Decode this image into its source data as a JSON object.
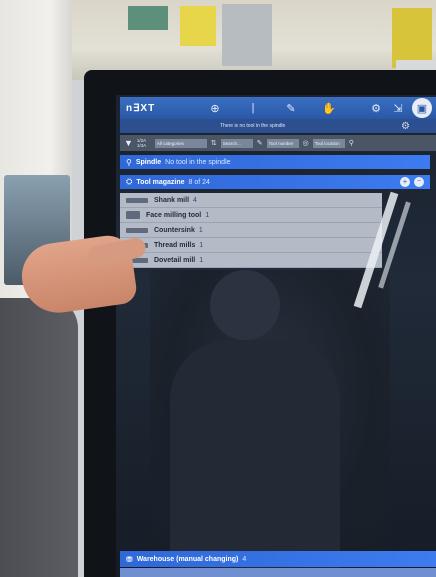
{
  "app": {
    "logo": "n∃XT"
  },
  "topbar": {
    "user_text": "",
    "icons": [
      "crosshair-icon",
      "line-icon",
      "edit-icon",
      "hand-icon",
      "tool-icon",
      "export-icon",
      "machine-icon"
    ]
  },
  "statusbar": {
    "message": "There is no tool in the spindle"
  },
  "filterbar": {
    "code_line1": "1/2A",
    "code_line2": "1/3A",
    "select_value": "All categories",
    "box1": "Search...",
    "box2": "Tool number",
    "box3": "Tool location"
  },
  "spindle": {
    "title": "Spindle",
    "subtitle": "No tool in the spindle"
  },
  "magazine": {
    "title": "Tool magazine",
    "count": "8 of 24"
  },
  "tools": [
    {
      "name": "Shank mill",
      "count": "4"
    },
    {
      "name": "Face milling tool",
      "count": "1"
    },
    {
      "name": "Countersink",
      "count": "1"
    },
    {
      "name": "Thread mills",
      "count": "1"
    },
    {
      "name": "Dovetail mill",
      "count": "1"
    }
  ],
  "warehouse": {
    "title": "Warehouse (manual changing)",
    "count": "4"
  },
  "colors": {
    "accent": "#2f68d8",
    "topbar": "#2a58a6"
  }
}
